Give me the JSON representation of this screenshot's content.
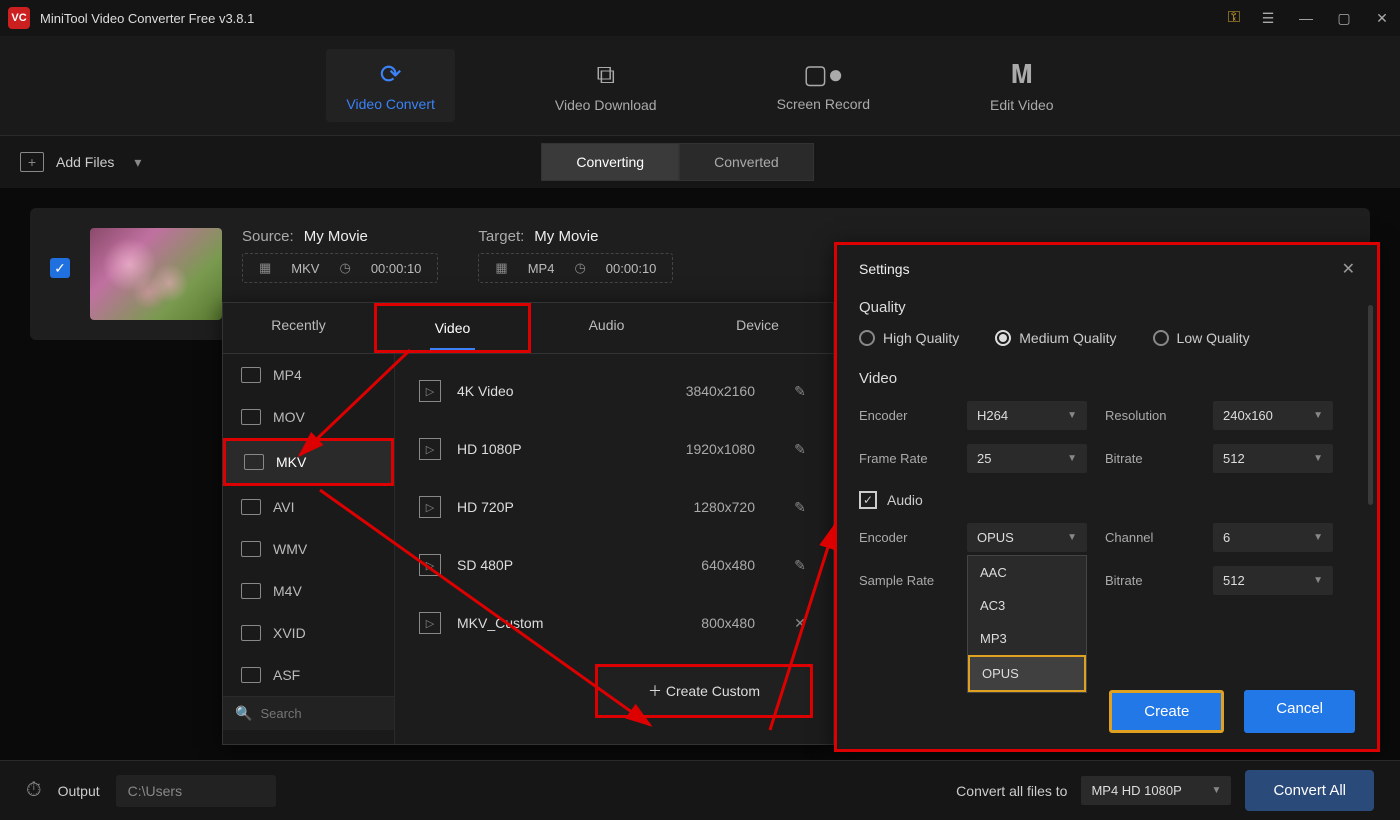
{
  "title": "MiniTool Video Converter Free v3.8.1",
  "nav": {
    "convert": "Video Convert",
    "download": "Video Download",
    "record": "Screen Record",
    "edit": "Edit Video"
  },
  "toolbar": {
    "add_files": "Add Files",
    "converting": "Converting",
    "converted": "Converted"
  },
  "file": {
    "source_lbl": "Source:",
    "source_name": "My Movie",
    "source_fmt": "MKV",
    "source_dur": "00:00:10",
    "target_lbl": "Target:",
    "target_name": "My Movie",
    "target_fmt": "MP4",
    "target_dur": "00:00:10"
  },
  "popup": {
    "tabs": {
      "recently": "Recently",
      "video": "Video",
      "audio": "Audio",
      "device": "Device"
    },
    "formats": [
      "MP4",
      "MOV",
      "MKV",
      "AVI",
      "WMV",
      "M4V",
      "XVID",
      "ASF"
    ],
    "presets": [
      {
        "name": "4K Video",
        "res": "3840x2160"
      },
      {
        "name": "HD 1080P",
        "res": "1920x1080"
      },
      {
        "name": "HD 720P",
        "res": "1280x720"
      },
      {
        "name": "SD 480P",
        "res": "640x480"
      },
      {
        "name": "MKV_Custom",
        "res": "800x480"
      }
    ],
    "search_ph": "Search",
    "create_custom": "Create Custom"
  },
  "settings": {
    "title": "Settings",
    "quality_lbl": "Quality",
    "quality": {
      "high": "High Quality",
      "medium": "Medium Quality",
      "low": "Low Quality"
    },
    "video_lbl": "Video",
    "audio_lbl": "Audio",
    "labels": {
      "encoder": "Encoder",
      "resolution": "Resolution",
      "framerate": "Frame Rate",
      "bitrate": "Bitrate",
      "channel": "Channel",
      "samplerate": "Sample Rate"
    },
    "video": {
      "encoder": "H264",
      "resolution": "240x160",
      "framerate": "25",
      "bitrate": "512"
    },
    "audio": {
      "encoder": "OPUS",
      "channel": "6",
      "bitrate": "512"
    },
    "encoder_options": [
      "AAC",
      "AC3",
      "MP3",
      "OPUS"
    ],
    "create": "Create",
    "cancel": "Cancel"
  },
  "bottom": {
    "output_lbl": "Output",
    "output_path": "C:\\Users",
    "convert_lbl": "Convert all files to",
    "convert_fmt": "MP4 HD 1080P",
    "convert_all": "Convert All"
  }
}
